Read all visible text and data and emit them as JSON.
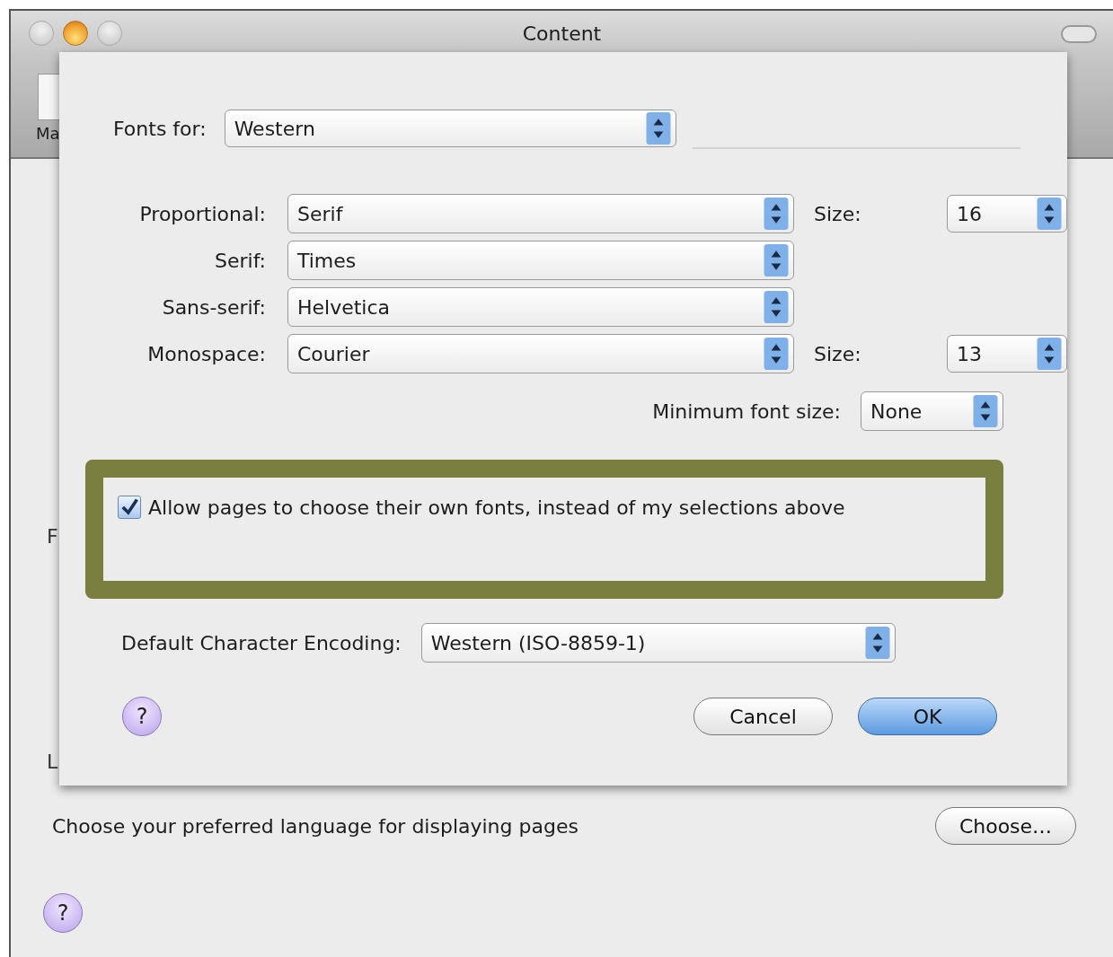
{
  "window": {
    "title": "Content"
  },
  "toolbar": {
    "items": [
      {
        "label": "Ma"
      }
    ]
  },
  "background": {
    "fragments": [
      {
        "text": "F"
      },
      {
        "text": "L"
      }
    ],
    "language": {
      "text": "Choose your preferred language for displaying pages",
      "button": "Choose…"
    },
    "help": "?"
  },
  "sheet": {
    "fonts_for": {
      "label": "Fonts for:",
      "value": "Western"
    },
    "font_rows": [
      {
        "label": "Proportional:",
        "value": "Serif",
        "size_label": "Size:",
        "size": "16"
      },
      {
        "label": "Serif:",
        "value": "Times"
      },
      {
        "label": "Sans-serif:",
        "value": "Helvetica"
      },
      {
        "label": "Monospace:",
        "value": "Courier",
        "size_label": "Size:",
        "size": "13"
      }
    ],
    "minimum_font_size": {
      "label": "Minimum font size:",
      "value": "None"
    },
    "allow_pages": {
      "label": "Allow pages to choose their own fonts, instead of my selections above",
      "checked": true,
      "highlighted": true
    },
    "encoding": {
      "label": "Default Character Encoding:",
      "value": "Western (ISO-8859-1)"
    },
    "help": "?",
    "buttons": [
      {
        "label": "Cancel",
        "default": false
      },
      {
        "label": "OK",
        "default": true
      }
    ]
  }
}
